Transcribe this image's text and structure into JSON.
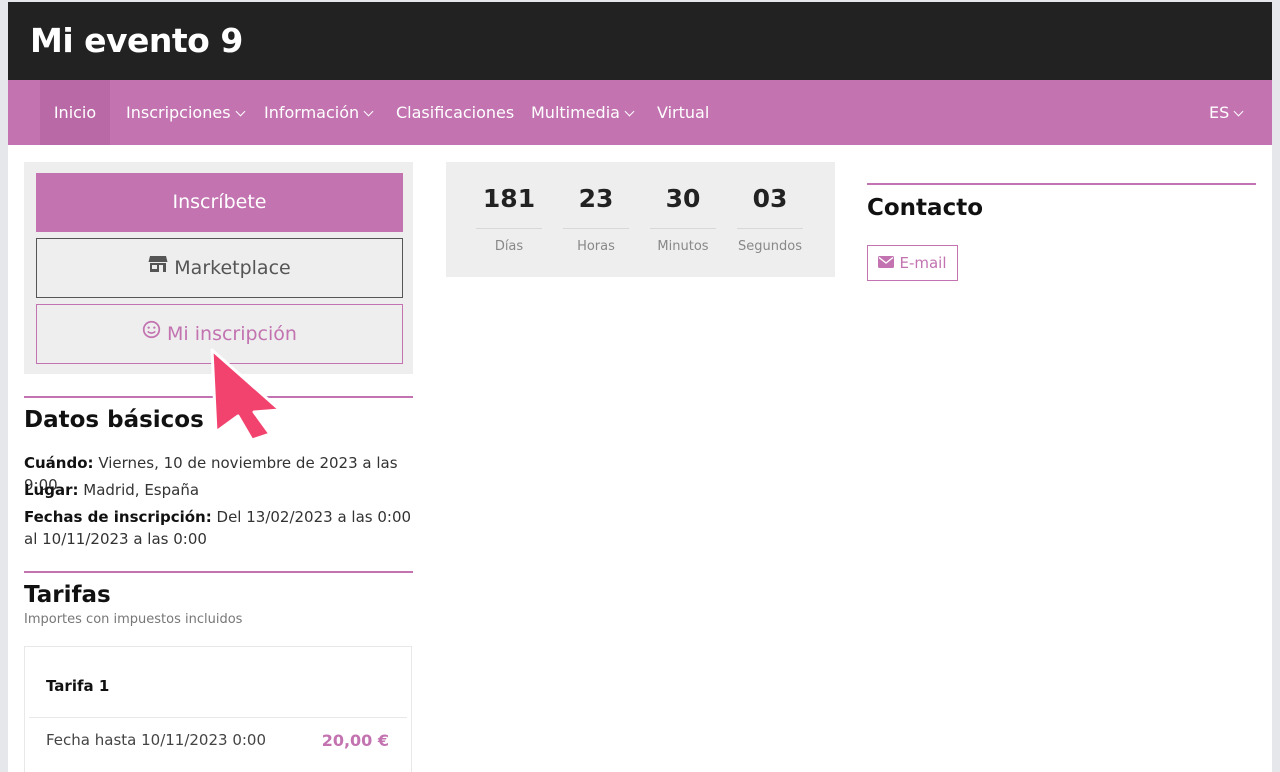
{
  "site": {
    "title": "Mi evento 9"
  },
  "nav": {
    "items": [
      {
        "label": "Inicio"
      },
      {
        "label": "Inscripciones"
      },
      {
        "label": "Información"
      },
      {
        "label": "Clasificaciones"
      },
      {
        "label": "Multimedia"
      },
      {
        "label": "Virtual"
      }
    ],
    "language": "ES"
  },
  "actions": {
    "register_label": "Inscríbete",
    "marketplace_label": "Marketplace",
    "my_registration_label": "Mi inscripción"
  },
  "countdown": {
    "days": {
      "value": "181",
      "label": "Días"
    },
    "hours": {
      "value": "23",
      "label": "Horas"
    },
    "minutes": {
      "value": "30",
      "label": "Minutos"
    },
    "seconds": {
      "value": "03",
      "label": "Segundos"
    }
  },
  "basic": {
    "title": "Datos básicos",
    "when_label": "Cuándo:",
    "when_value": "Viernes, 10 de noviembre de 2023 a las 9:00",
    "where_label": "Lugar:",
    "where_value": "Madrid, España",
    "dates_label": "Fechas de inscripción:",
    "dates_value": "Del 13/02/2023 a las 0:00 al 10/11/2023 a las 0:00"
  },
  "fees": {
    "title": "Tarifas",
    "note": "Importes con impuestos incluidos",
    "items": [
      {
        "name": "Tarifa 1",
        "date": "Fecha hasta 10/11/2023 0:00",
        "price": "20,00 €"
      }
    ]
  },
  "contact": {
    "title": "Contacto",
    "email_label": "E-mail"
  },
  "colors": {
    "accent": "#c273b0",
    "header": "#222222",
    "cursor": "#f2436f"
  },
  "icons": {
    "marketplace": "store-icon",
    "my_registration": "smile-icon",
    "email": "envelope-icon",
    "dropdown": "chevron-down-icon"
  }
}
